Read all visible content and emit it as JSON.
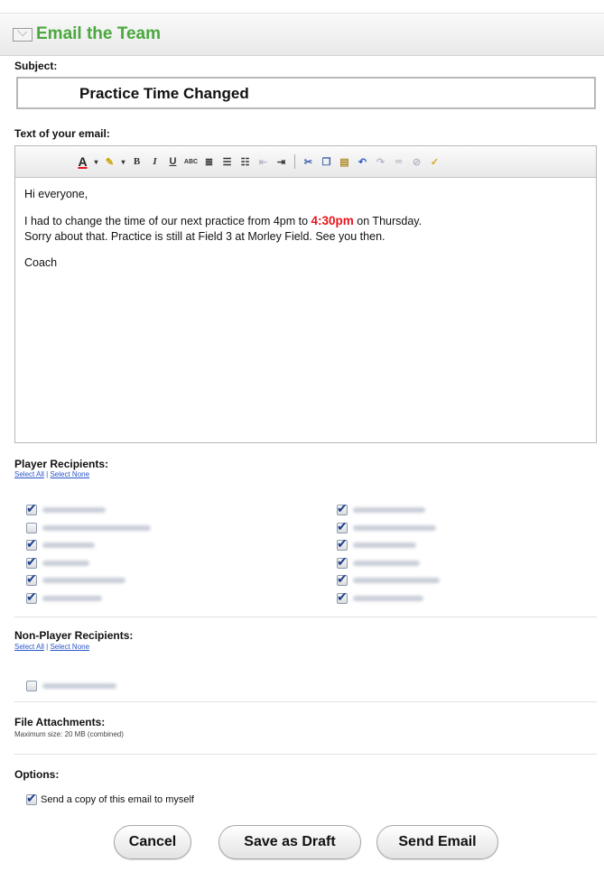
{
  "header": {
    "title": "Email the Team",
    "icon": "envelope-icon",
    "title_color": "#4aa83d"
  },
  "subject": {
    "label": "Subject:",
    "value": "Practice Time Changed"
  },
  "editor": {
    "label": "Text of your email:",
    "toolbar": [
      "font-color-icon",
      "highlight-icon",
      "bold-icon",
      "italic-icon",
      "underline-icon",
      "spellcheck-icon",
      "justify-icon",
      "bullet-list-icon",
      "numbered-list-icon",
      "outdent-icon",
      "indent-icon",
      "cut-icon",
      "copy-icon",
      "paste-icon",
      "undo-icon",
      "redo-icon",
      "link-icon",
      "unlink-icon",
      "clean-icon"
    ],
    "greeting": "Hi everyone,",
    "line1_a": "I had to change the time of our next practice from 4pm to ",
    "line1_highlight": "4:30pm",
    "line1_b": " on Thursday.",
    "line2": "Sorry about that. Practice is still at Field 3 at Morley Field. See you then.",
    "signoff": "Coach",
    "highlight_color": "#e8141c"
  },
  "player_recipients": {
    "label": "Player Recipients:",
    "select_all": "Select All",
    "divider": "|",
    "select_none": "Select None",
    "left": [
      {
        "checked": true
      },
      {
        "checked": false
      },
      {
        "checked": true
      },
      {
        "checked": true
      },
      {
        "checked": true
      },
      {
        "checked": true
      }
    ],
    "right": [
      {
        "checked": true
      },
      {
        "checked": true
      },
      {
        "checked": true
      },
      {
        "checked": true
      },
      {
        "checked": true
      },
      {
        "checked": true
      }
    ]
  },
  "non_player_recipients": {
    "label": "Non-Player Recipients:",
    "select_all": "Select All",
    "divider": "|",
    "select_none": "Select None",
    "items": [
      {
        "checked": false
      }
    ]
  },
  "attachments": {
    "label": "File Attachments:",
    "note": "Maximum size: 20 MB (combined)"
  },
  "options": {
    "label": "Options:",
    "copy_to_self": "Send a copy of this email to myself",
    "copy_checked": true
  },
  "buttons": {
    "cancel": "Cancel",
    "save_draft": "Save as Draft",
    "send": "Send Email"
  }
}
